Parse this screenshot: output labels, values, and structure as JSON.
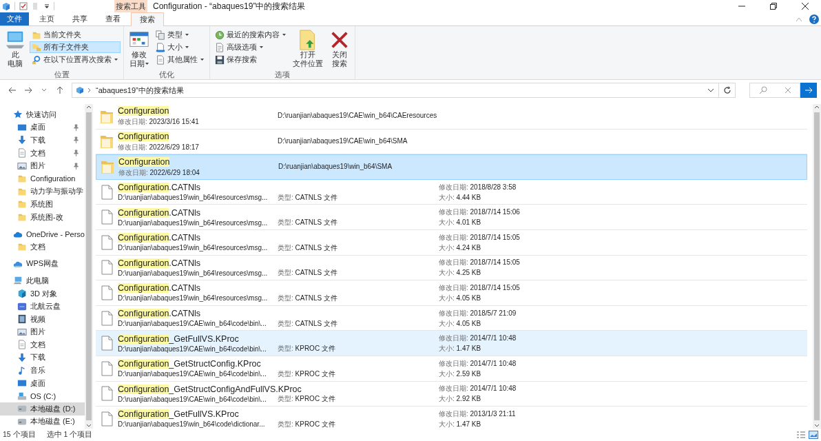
{
  "title_bar": {
    "context_label": "搜索工具",
    "title": "Configuration - “abaques19”中的搜索结果"
  },
  "tabs": [
    {
      "label": "文件",
      "kind": "file",
      "selected": false
    },
    {
      "label": "主页",
      "kind": "normal",
      "selected": false
    },
    {
      "label": "共享",
      "kind": "normal",
      "selected": false
    },
    {
      "label": "查看",
      "kind": "normal",
      "selected": false
    },
    {
      "label": "搜索",
      "kind": "normal",
      "selected": true
    }
  ],
  "ribbon": {
    "groups": [
      {
        "label": "位置",
        "items": [
          {
            "kind": "large",
            "lines": [
              "此",
              "电脑"
            ],
            "dropdown": false
          },
          {
            "kind": "stack",
            "buttons": [
              {
                "label": "当前文件夹",
                "dropdown": false,
                "selected": false
              },
              {
                "label": "所有子文件夹",
                "dropdown": false,
                "selected": true
              },
              {
                "label": "在以下位置再次搜索",
                "dropdown": true,
                "selected": false
              }
            ]
          }
        ]
      },
      {
        "label": "优化",
        "items": [
          {
            "kind": "large",
            "lines": [
              "修改",
              "日期"
            ],
            "dropdown": true
          },
          {
            "kind": "stack",
            "buttons": [
              {
                "label": "类型",
                "dropdown": true,
                "selected": false
              },
              {
                "label": "大小",
                "dropdown": true,
                "selected": false
              },
              {
                "label": "其他属性",
                "dropdown": true,
                "selected": false
              }
            ]
          }
        ]
      },
      {
        "label": "选项",
        "items": [
          {
            "kind": "stack",
            "buttons": [
              {
                "label": "最近的搜索内容",
                "dropdown": true,
                "selected": false
              },
              {
                "label": "高级选项",
                "dropdown": true,
                "selected": false
              },
              {
                "label": "保存搜索",
                "dropdown": false,
                "selected": false
              }
            ]
          },
          {
            "kind": "large",
            "lines": [
              "打开",
              "文件位置"
            ],
            "dropdown": false
          },
          {
            "kind": "large",
            "lines": [
              "关闭",
              "搜索"
            ],
            "dropdown": false
          }
        ]
      }
    ]
  },
  "address_bar": {
    "crumb": "“abaques19”中的搜索结果"
  },
  "sidebar": {
    "items": [
      {
        "label": "快速访问",
        "children": [
          {
            "label": "桌面",
            "pinned": true
          },
          {
            "label": "下载",
            "pinned": true
          },
          {
            "label": "文档",
            "pinned": true
          },
          {
            "label": "图片",
            "pinned": true
          },
          {
            "label": "Configuration",
            "pinned": false
          },
          {
            "label": "动力学与振动学",
            "pinned": false
          },
          {
            "label": "系统图",
            "pinned": false
          },
          {
            "label": "系统图-改",
            "pinned": false
          }
        ]
      },
      {
        "label": "OneDrive - Perso",
        "children": [
          {
            "label": "文档",
            "pinned": false
          }
        ]
      },
      {
        "label": "WPS网盘"
      },
      {
        "label": "此电脑",
        "children": [
          {
            "label": "3D 对象",
            "pinned": false
          },
          {
            "label": "北航云盘",
            "pinned": false
          },
          {
            "label": "视频",
            "pinned": false
          },
          {
            "label": "图片",
            "pinned": false
          },
          {
            "label": "文档",
            "pinned": false
          },
          {
            "label": "下载",
            "pinned": false
          },
          {
            "label": "音乐",
            "pinned": false
          },
          {
            "label": "桌面",
            "pinned": false
          },
          {
            "label": "OS (C:)",
            "pinned": false,
            "selected": false
          },
          {
            "label": "本地磁盘 (D:)",
            "pinned": false,
            "selected": true
          },
          {
            "label": "本地磁盘 (E:)",
            "pinned": false,
            "selected": false
          }
        ]
      }
    ]
  },
  "files": [
    {
      "kind": "folder",
      "name_match": "Configuration",
      "path": "D:\\ruanjian\\abaques19\\CAE\\win_b64\\CAEresources",
      "date_label": "修改日期:",
      "date": "2023/3/16 15:41",
      "selected": false,
      "hovered": false
    },
    {
      "kind": "folder",
      "name_match": "Configuration",
      "path": "D:\\ruanjian\\abaques19\\CAE\\win_b64\\SMA",
      "date_label": "修改日期:",
      "date": "2022/6/29 18:17",
      "selected": false,
      "hovered": false
    },
    {
      "kind": "folder",
      "name_match": "Configuration",
      "path": "D:\\ruanjian\\abaques19\\win_b64\\SMA",
      "date_label": "修改日期:",
      "date": "2022/6/29 18:04",
      "selected": true,
      "hovered": false
    },
    {
      "kind": "file",
      "name_match": "Configuration",
      "name_rest": ".CATNls",
      "path": "D:\\ruanjian\\abaques19\\win_b64\\resources\\msg...",
      "type_label": "类型:",
      "type": "CATNLS 文件",
      "date_label": "修改日期:",
      "date": "2018/8/28 3:58",
      "size_label": "大小:",
      "size": "4.44 KB",
      "selected": false,
      "hovered": false
    },
    {
      "kind": "file",
      "name_match": "Configuration",
      "name_rest": ".CATNls",
      "path": "D:\\ruanjian\\abaques19\\win_b64\\resources\\msg...",
      "type_label": "类型:",
      "type": "CATNLS 文件",
      "date_label": "修改日期:",
      "date": "2018/7/14 15:06",
      "size_label": "大小:",
      "size": "4.01 KB",
      "selected": false,
      "hovered": false
    },
    {
      "kind": "file",
      "name_match": "Configuration",
      "name_rest": ".CATNls",
      "path": "D:\\ruanjian\\abaques19\\win_b64\\resources\\msg...",
      "type_label": "类型:",
      "type": "CATNLS 文件",
      "date_label": "修改日期:",
      "date": "2018/7/14 15:05",
      "size_label": "大小:",
      "size": "4.24 KB",
      "selected": false,
      "hovered": false
    },
    {
      "kind": "file",
      "name_match": "Configuration",
      "name_rest": ".CATNls",
      "path": "D:\\ruanjian\\abaques19\\win_b64\\resources\\msg...",
      "type_label": "类型:",
      "type": "CATNLS 文件",
      "date_label": "修改日期:",
      "date": "2018/7/14 15:05",
      "size_label": "大小:",
      "size": "4.25 KB",
      "selected": false,
      "hovered": false
    },
    {
      "kind": "file",
      "name_match": "Configuration",
      "name_rest": ".CATNls",
      "path": "D:\\ruanjian\\abaques19\\win_b64\\resources\\msg...",
      "type_label": "类型:",
      "type": "CATNLS 文件",
      "date_label": "修改日期:",
      "date": "2018/7/14 15:05",
      "size_label": "大小:",
      "size": "4.05 KB",
      "selected": false,
      "hovered": false
    },
    {
      "kind": "file",
      "name_match": "Configuration",
      "name_rest": ".CATNls",
      "path": "D:\\ruanjian\\abaques19\\CAE\\win_b64\\code\\bin\\...",
      "type_label": "类型:",
      "type": "CATNLS 文件",
      "date_label": "修改日期:",
      "date": "2018/5/7 21:09",
      "size_label": "大小:",
      "size": "4.05 KB",
      "selected": false,
      "hovered": false
    },
    {
      "kind": "file",
      "name_match": "Configuration",
      "name_rest": "_GetFullVS.KProc",
      "path": "D:\\ruanjian\\abaques19\\CAE\\win_b64\\code\\bin\\...",
      "type_label": "类型:",
      "type": "KPROC 文件",
      "date_label": "修改日期:",
      "date": "2014/7/1 10:48",
      "size_label": "大小:",
      "size": "1.47 KB",
      "selected": false,
      "hovered": true
    },
    {
      "kind": "file",
      "name_match": "Configuration",
      "name_rest": "_GetStructConfig.KProc",
      "path": "D:\\ruanjian\\abaques19\\CAE\\win_b64\\code\\bin\\...",
      "type_label": "类型:",
      "type": "KPROC 文件",
      "date_label": "修改日期:",
      "date": "2014/7/1 10:48",
      "size_label": "大小:",
      "size": "2.59 KB",
      "selected": false,
      "hovered": false
    },
    {
      "kind": "file",
      "name_match": "Configuration",
      "name_rest": "_GetStructConfigAndFullVS.KProc",
      "path": "D:\\ruanjian\\abaques19\\CAE\\win_b64\\code\\bin\\...",
      "type_label": "类型:",
      "type": "KPROC 文件",
      "date_label": "修改日期:",
      "date": "2014/7/1 10:48",
      "size_label": "大小:",
      "size": "2.92 KB",
      "selected": false,
      "hovered": false
    },
    {
      "kind": "file",
      "name_match": "Configuration",
      "name_rest": "_GetFullVS.KProc",
      "path": "D:\\ruanjian\\abaques19\\win_b64\\code\\dictionar...",
      "type_label": "类型:",
      "type": "KPROC 文件",
      "date_label": "修改日期:",
      "date": "2013/1/3 21:11",
      "size_label": "大小:",
      "size": "1.47 KB",
      "selected": false,
      "hovered": false
    }
  ],
  "status_bar": {
    "count": "15 个项目",
    "selection": "选中 1 个项目"
  }
}
